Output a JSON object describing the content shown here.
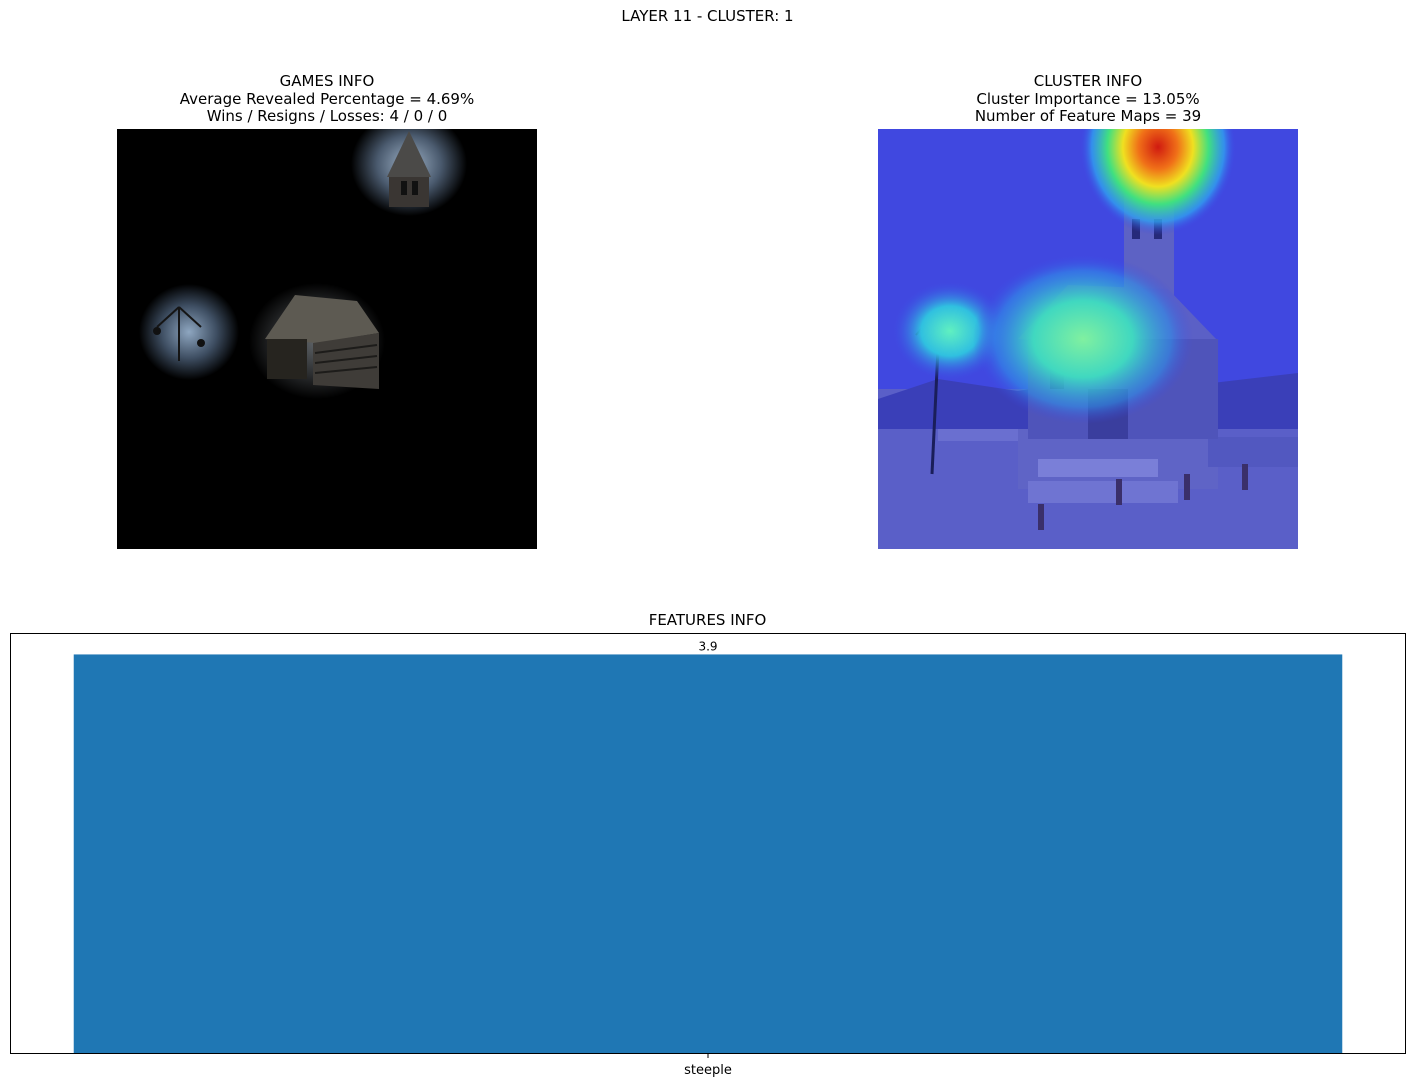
{
  "suptitle": "LAYER 11 - CLUSTER: 1",
  "games_info": {
    "title": "GAMES INFO",
    "line1": "Average Revealed Percentage = 4.69%",
    "line2": "Wins / Resigns / Losses: 4 / 0 / 0"
  },
  "cluster_info": {
    "title": "CLUSTER INFO",
    "line1": "Cluster Importance = 13.05%",
    "line2": "Number of Feature Maps = 39"
  },
  "chart_data": {
    "type": "bar",
    "title": "FEATURES INFO",
    "categories": [
      "steeple"
    ],
    "values": [
      3.9
    ],
    "data_labels": [
      "3.9"
    ],
    "ylim": [
      0,
      4.1
    ],
    "bar_color": "#1f77b4",
    "xlabel": "",
    "ylabel": "",
    "y_ticks_visible": false,
    "grid": false
  },
  "colors": {
    "bar": "#1f77b4",
    "overlay_blue": "#3c46e6",
    "heat_red": "#d01a10",
    "heat_yellow": "#f0e020",
    "heat_green": "#40e080"
  }
}
